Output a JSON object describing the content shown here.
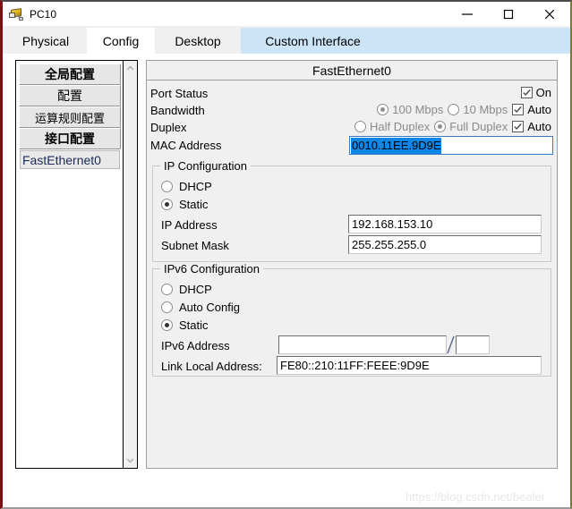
{
  "window": {
    "title": "PC10",
    "icon": "pc-device-icon",
    "buttons": {
      "minimize": "minimize-icon",
      "maximize": "maximize-icon",
      "close": "close-icon"
    }
  },
  "tabs": [
    {
      "label": "Physical",
      "state": "normal"
    },
    {
      "label": "Config",
      "state": "selected"
    },
    {
      "label": "Desktop",
      "state": "normal"
    },
    {
      "label": "Custom Interface",
      "state": "hover"
    }
  ],
  "sidebar": {
    "items": [
      {
        "label": "全局配置",
        "type": "button",
        "bold": true
      },
      {
        "label": "配置",
        "type": "button",
        "bold": false
      },
      {
        "label": "运算规则配置",
        "type": "button",
        "bold": false
      },
      {
        "label": "接口配置",
        "type": "button",
        "bold": true
      },
      {
        "label": "FastEthernet0",
        "type": "list-item",
        "selected": true
      }
    ],
    "scrollbar": {
      "up": "chevron-up-icon",
      "down": "chevron-down-icon"
    }
  },
  "panel": {
    "header": "FastEthernet0",
    "port_status": {
      "label": "Port Status",
      "checkbox_label": "On",
      "checked": true
    },
    "bandwidth": {
      "label": "Bandwidth",
      "options": [
        {
          "label": "100 Mbps",
          "selected": true,
          "disabled": true
        },
        {
          "label": "10 Mbps",
          "selected": false,
          "disabled": true
        }
      ],
      "auto_label": "Auto",
      "auto_checked": true
    },
    "duplex": {
      "label": "Duplex",
      "options": [
        {
          "label": "Half Duplex",
          "selected": false,
          "disabled": true
        },
        {
          "label": "Full Duplex",
          "selected": true,
          "disabled": true
        }
      ],
      "auto_label": "Auto",
      "auto_checked": true
    },
    "mac": {
      "label": "MAC Address",
      "value": "0010.11EE.9D9E",
      "selected": true,
      "selection_color": "#0e86e8"
    },
    "ip_config": {
      "legend": "IP Configuration",
      "modes": [
        {
          "label": "DHCP",
          "selected": false
        },
        {
          "label": "Static",
          "selected": true
        }
      ],
      "fields": [
        {
          "label": "IP Address",
          "value": "192.168.153.10",
          "placeholder": ""
        },
        {
          "label": "Subnet Mask",
          "value": "255.255.255.0",
          "placeholder": ""
        }
      ]
    },
    "ipv6_config": {
      "legend": "IPv6 Configuration",
      "modes": [
        {
          "label": "DHCP",
          "selected": false
        },
        {
          "label": "Auto Config",
          "selected": false
        },
        {
          "label": "Static",
          "selected": true
        }
      ],
      "ipv6_address": {
        "label": "IPv6 Address",
        "value": "",
        "placeholder": "",
        "separator": "/",
        "prefix_value": ""
      },
      "link_local": {
        "label": "Link Local Address:",
        "value": "FE80::210:11FF:FEEE:9D9E"
      }
    }
  },
  "watermark": "https://blog.csdn.net/bealei"
}
